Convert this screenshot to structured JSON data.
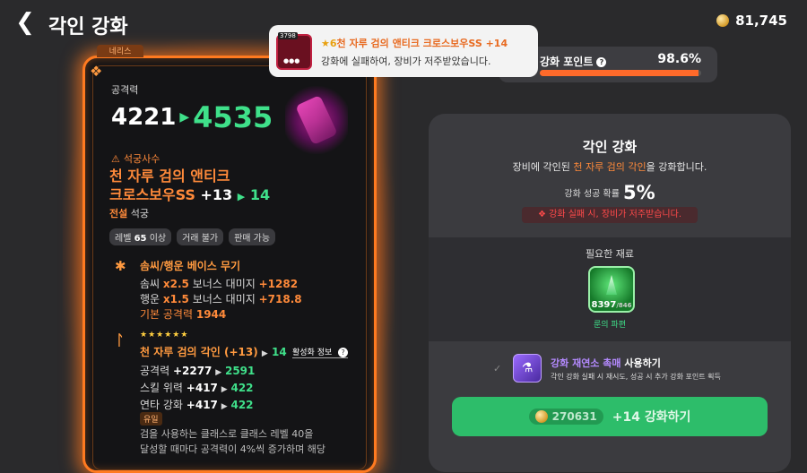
{
  "header": {
    "back_icon": "chevron-left-icon",
    "title": "각인 강화",
    "gold": "81,745"
  },
  "card": {
    "tab_label": "네리스",
    "attack_label": "공격력",
    "attack_old": "4221",
    "attack_new": "4535",
    "class_label": "석궁사수",
    "item_name_line1": "천 자루 검의 앤티크",
    "item_name_line2": "크로스보우SS",
    "item_level": "+13",
    "item_level_new": "14",
    "grade_type": "전설",
    "grade_weapon": "석궁",
    "tags": [
      {
        "pre": "레벨 ",
        "bold": "65",
        "post": " 이상"
      },
      {
        "pre": "거래 불가",
        "bold": "",
        "post": ""
      },
      {
        "pre": "판매 가능",
        "bold": "",
        "post": ""
      }
    ],
    "base_title": "솜씨/행운 베이스 무기",
    "base_stats": [
      {
        "label": "솜씨 ",
        "mult": "x2.5",
        "text": " 보너스 대미지 ",
        "value": "+1282"
      },
      {
        "label": "행운 ",
        "mult": "x1.5",
        "text": " 보너스 대미지 ",
        "value": "+718.8"
      }
    ],
    "base_atk_label": "기본 공격력",
    "base_atk_value": "1944",
    "stars": "★★★★★★",
    "engrave_title": "천 자루 검의 각인 (+13)",
    "engrave_new": "14",
    "activation_info": "활성화 정보",
    "engrave_stats": [
      {
        "label": "공격력 ",
        "old": "+2277",
        "new": "2591"
      },
      {
        "label": "스킬 위력 ",
        "old": "+417",
        "new": "422"
      },
      {
        "label": "연타 강화 ",
        "old": "+417",
        "new": "422"
      }
    ],
    "unique_badge": "유일",
    "desc_line1": "검을 사용하는 클래스로 클래스 레벨 40을",
    "desc_line2": "달성할 때마다 공격력이 4%씩 증가하며 해당"
  },
  "notification": {
    "thumb_tag": "3798",
    "star_level": "★6",
    "title": "천 자루 검의 앤티크 크로스보우SS +14",
    "body": "강화에 실패하여, 장비가 저주받았습니다."
  },
  "enhance_point": {
    "label": "강화 포인트",
    "value": "98.6%",
    "fill_pct": 98.6
  },
  "panel": {
    "title": "각인 강화",
    "sub_pre": "장비에 각인된 ",
    "sub_item": "천 자루 검의 각인",
    "sub_post": "을 강화합니다.",
    "rate_label": "강화 성공 확률",
    "rate_value": "5%",
    "warning": "강화 실패 시, 장비가 저주받습니다.",
    "material_label": "필요한 재료",
    "material_count": "8397",
    "material_need": "/846",
    "material_name": "룬의 파편",
    "use_title_highlight": "강화 재연소 촉매",
    "use_title_rest": " 사용하기",
    "use_desc": "각인 강화 실패 시 재시도, 성공 시 추가 강화 포인트 획득",
    "button_cost": "270631",
    "button_label": "+14 강화하기"
  },
  "colors": {
    "accent_orange": "#ff8a3a",
    "success_green": "#3fe08a",
    "button_green": "#2dbd6a",
    "warning_red": "#ff4a4a"
  }
}
